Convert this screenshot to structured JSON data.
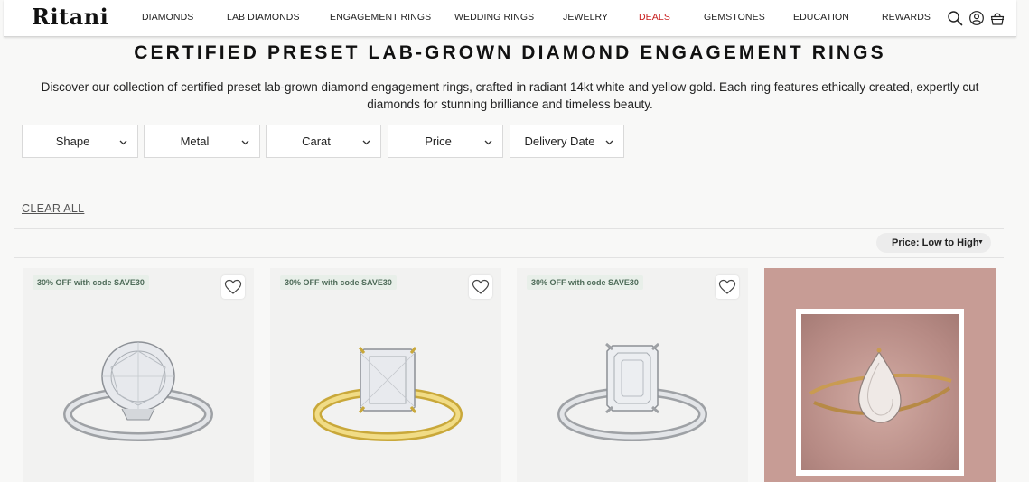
{
  "header": {
    "logo": "Ritani",
    "nav": [
      "DIAMONDS",
      "LAB DIAMONDS",
      "ENGAGEMENT RINGS",
      "WEDDING RINGS",
      "JEWELRY",
      "DEALS",
      "GEMSTONES",
      "EDUCATION",
      "REWARDS"
    ],
    "deals_color": "#c81e1e"
  },
  "page": {
    "title": "CERTIFIED PRESET LAB-GROWN DIAMOND ENGAGEMENT RINGS",
    "description": "Discover our collection of certified preset lab-grown diamond engagement rings, crafted in radiant 14kt white and yellow gold. Each ring features ethically created, expertly cut diamonds for stunning brilliance and timeless beauty."
  },
  "filters": [
    "Shape",
    "Metal",
    "Carat",
    "Price",
    "Delivery Date"
  ],
  "clear_all": "CLEAR ALL",
  "sort": {
    "label": "Price: Low to High"
  },
  "products": [
    {
      "badge": "30% OFF with code SAVE30",
      "shape": "oval",
      "metal": "white gold",
      "icon": "ring-oval-icon"
    },
    {
      "badge": "30% OFF with code SAVE30",
      "shape": "radiant",
      "metal": "yellow gold",
      "icon": "ring-radiant-icon"
    },
    {
      "badge": "30% OFF with code SAVE30",
      "shape": "emerald",
      "metal": "white gold",
      "icon": "ring-emerald-icon"
    }
  ],
  "lifestyle": {
    "shape": "pear",
    "metal": "yellow gold"
  },
  "colors": {
    "background": "#f8f8f7",
    "card": "#f2f2f1",
    "badge_bg": "#e8efe9",
    "badge_text": "#4d6b58",
    "lifestyle_bg": "#c79c95"
  }
}
